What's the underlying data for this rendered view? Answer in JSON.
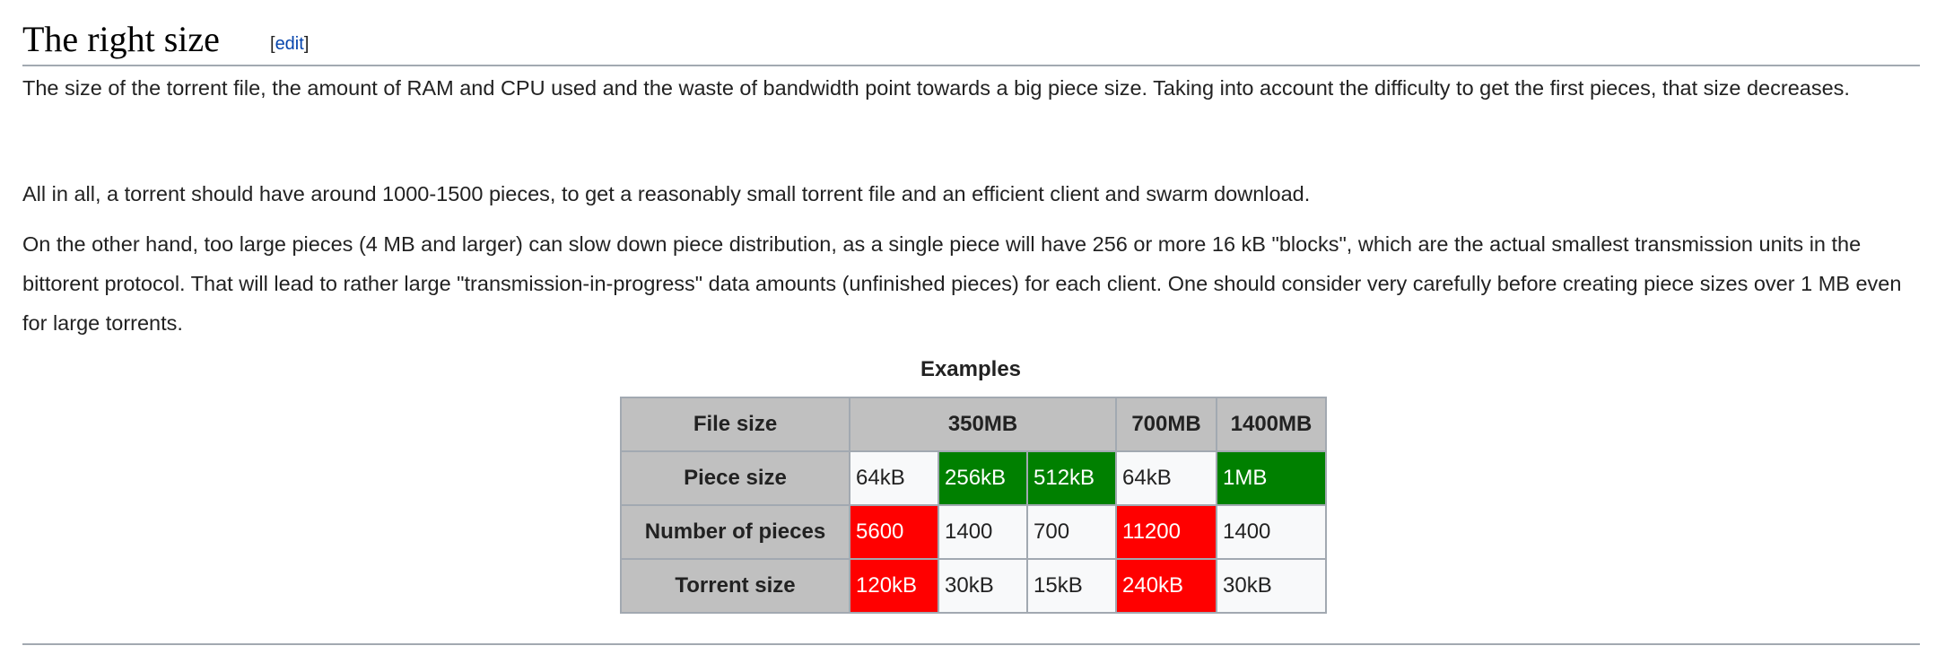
{
  "heading": {
    "title": "The right size",
    "edit_open": "[",
    "edit_label": "edit",
    "edit_close": "]"
  },
  "paragraphs": [
    "The size of the torrent file, the amount of RAM and CPU used and the waste of bandwidth point towards a big piece size. Taking into account the difficulty to get the first pieces, that size decreases.",
    "All in all, a torrent should have around 1000-1500 pieces, to get a reasonably small torrent file and an efficient client and swarm download.",
    "On the other hand, too large pieces (4 MB and larger) can slow down piece distribution, as a single piece will have 256 or more 16 kB \"blocks\", which are the actual smallest transmission units in the bittorent protocol. That will lead to rather large \"transmission-in-progress\" data amounts (unfinished pieces) for each client. One should consider very carefully before creating piece sizes over 1 MB even for large torrents."
  ],
  "table": {
    "caption": "Examples",
    "file_size": {
      "label": "File size",
      "values": [
        "350MB",
        "700MB",
        "1400MB"
      ]
    },
    "piece_size": {
      "label": "Piece size",
      "values": [
        "64kB",
        "256kB",
        "512kB",
        "64kB",
        "1MB"
      ]
    },
    "num_pieces": {
      "label": "Number of pieces",
      "values": [
        "5600",
        "1400",
        "700",
        "11200",
        "1400"
      ]
    },
    "torrent_size": {
      "label": "Torrent size",
      "values": [
        "120kB",
        "30kB",
        "15kB",
        "240kB",
        "30kB"
      ]
    },
    "colors": {
      "good": "#008000",
      "bad": "#ff0000",
      "header": "#c0c0c0"
    }
  }
}
